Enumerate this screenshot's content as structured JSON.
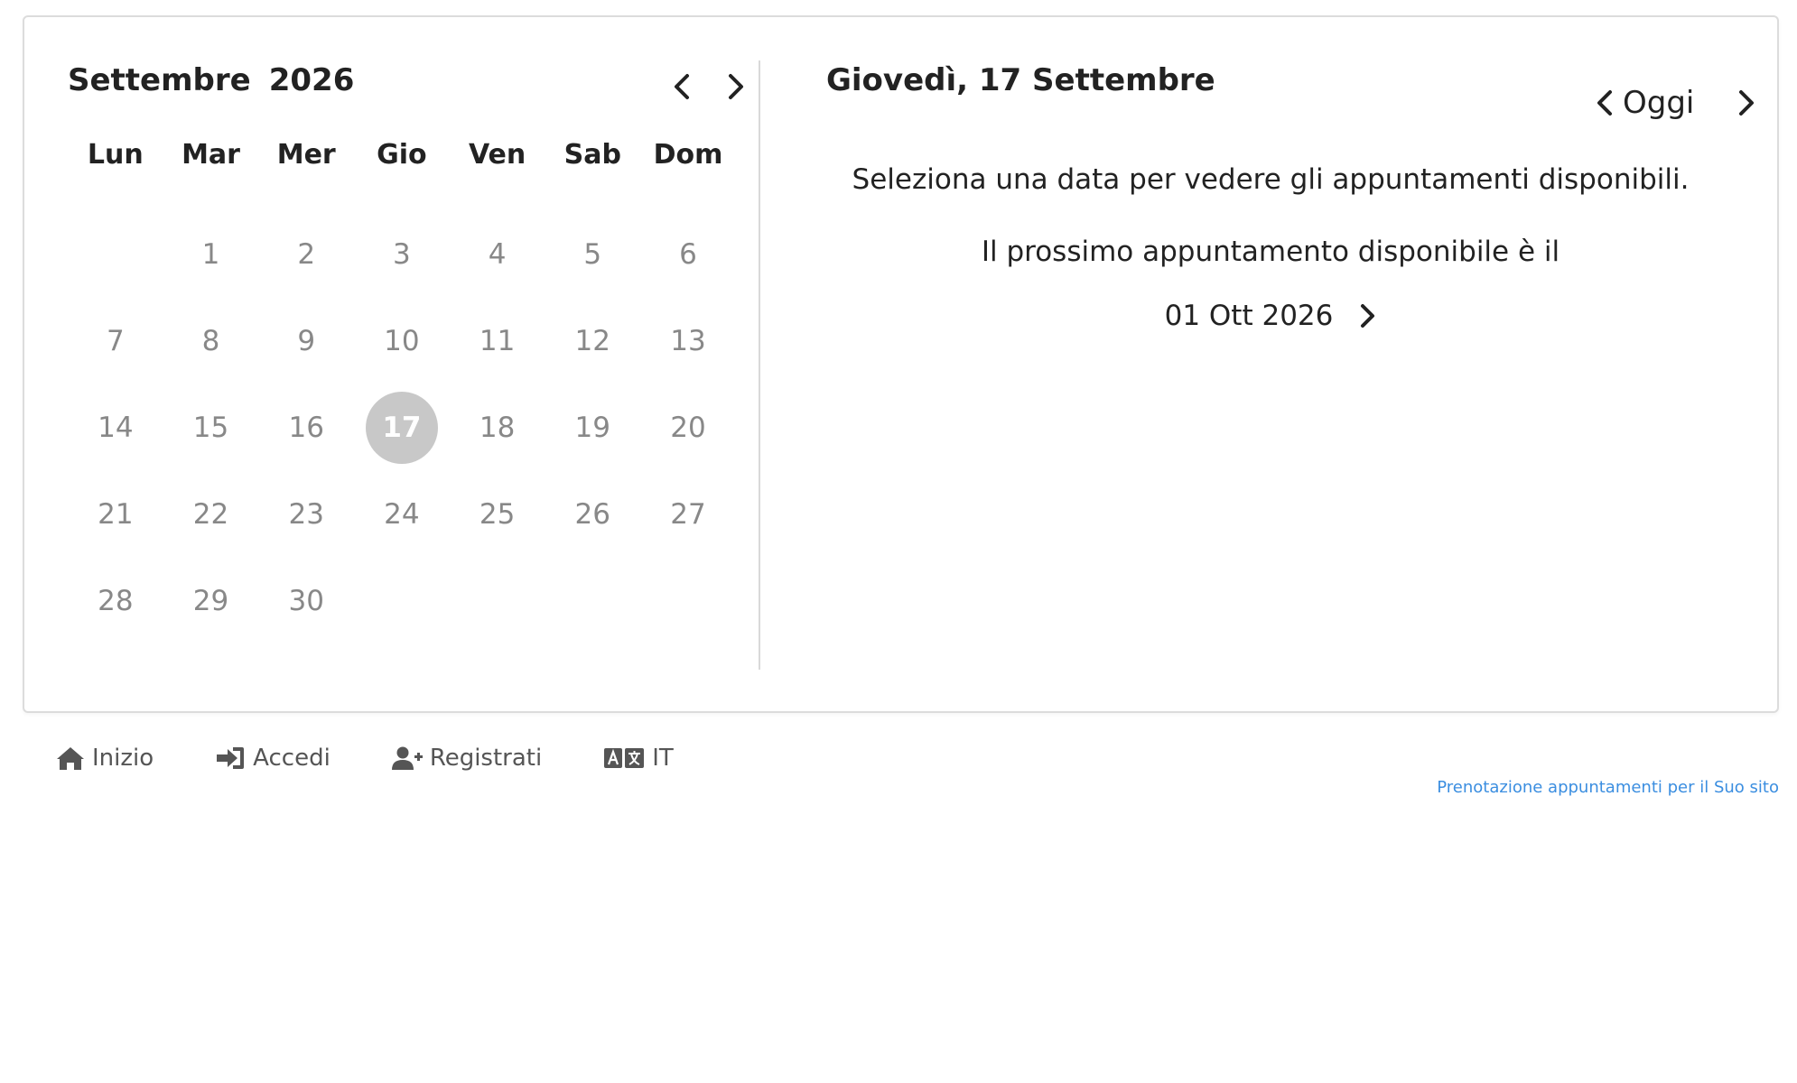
{
  "calendar": {
    "month": "Settembre",
    "year": "2026",
    "weekdays": [
      "Lun",
      "Mar",
      "Mer",
      "Gio",
      "Ven",
      "Sab",
      "Dom"
    ],
    "first_weekday_offset": 1,
    "days": [
      "1",
      "2",
      "3",
      "4",
      "5",
      "6",
      "7",
      "8",
      "9",
      "10",
      "11",
      "12",
      "13",
      "14",
      "15",
      "16",
      "17",
      "18",
      "19",
      "20",
      "21",
      "22",
      "23",
      "24",
      "25",
      "26",
      "27",
      "28",
      "29",
      "30"
    ],
    "selected_day": "17"
  },
  "panel": {
    "title": "Giovedì, 17 Settembre",
    "today_label": "Oggi",
    "select_message": "Seleziona una data per vedere gli appuntamenti disponibili.",
    "next_message": "Il prossimo appuntamento disponibile è il",
    "next_date": "01 Ott 2026"
  },
  "footer": {
    "home_label": "Inizio",
    "login_label": "Accedi",
    "register_label": "Registrati",
    "language_label": "IT",
    "credit": "Prenotazione appuntamenti per il Suo sito"
  },
  "colors": {
    "selected_circle": "#c8c8c8",
    "day_text": "#888888",
    "credit_link": "#3b8ee0"
  }
}
